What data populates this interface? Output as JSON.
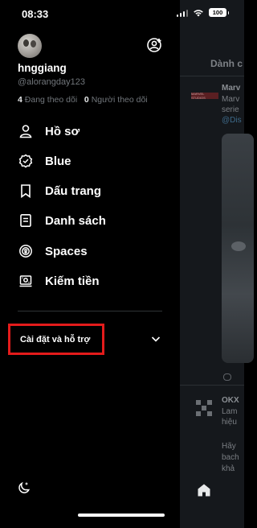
{
  "status_bar": {
    "time": "08:33",
    "battery": "100"
  },
  "profile": {
    "display_name": "hnggiang",
    "handle": "@alorangday123",
    "following_count": "4",
    "following_label": "Đang theo dõi",
    "followers_count": "0",
    "followers_label": "Người theo dõi"
  },
  "menu": {
    "items": [
      {
        "label": "Hồ sơ",
        "icon": "person-icon"
      },
      {
        "label": "Blue",
        "icon": "verified-badge-icon"
      },
      {
        "label": "Dấu trang",
        "icon": "bookmark-icon"
      },
      {
        "label": "Danh sách",
        "icon": "list-icon"
      },
      {
        "label": "Spaces",
        "icon": "spaces-icon"
      },
      {
        "label": "Kiếm tiền",
        "icon": "money-icon"
      }
    ]
  },
  "settings": {
    "label": "Cài đặt và hỗ trợ"
  },
  "background": {
    "tab_label": "Dành c",
    "post1_author": "Marv",
    "post1_lines": [
      "Marv",
      "serie",
      "@Dis"
    ],
    "post2_author": "OKX",
    "post2_lines": [
      "Lam",
      "hiệu",
      "Hãy",
      "bach",
      "khả"
    ]
  },
  "colors": {
    "highlight_box": "#e31b1b",
    "accent": "#1d9bf0",
    "secondary_text": "#71767b"
  }
}
